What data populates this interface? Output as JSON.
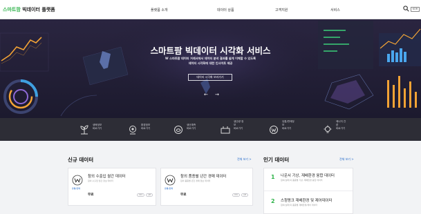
{
  "header": {
    "logo_brand": "스마트팜",
    "logo_rest": " 빅데이터 플랫폼",
    "nav": [
      "플랫폼 소개",
      "데이터 상품",
      "고객지원",
      "서비스"
    ],
    "lang": "KOR"
  },
  "hero": {
    "title": "스마트팜 빅데이터 시각화 서비스",
    "subtitle_line1": "W 스마트팜 데이터 거래서에서 데이터 분석 결과를 쉽게 이해할 수 있도록",
    "subtitle_line2": "데이터 시각화에 대한 인사이트 제공",
    "button": "데이터 시각화 보러가기",
    "prev": "←",
    "next": "→"
  },
  "services": [
    {
      "icon": "sprout-icon",
      "label_lines": [
        "생육정보",
        "바로가기"
      ]
    },
    {
      "icon": "environment-icon",
      "label_lines": [
        "환경정보",
        "바로가기"
      ]
    },
    {
      "icon": "yield-forecast-icon",
      "label_lines": [
        "생산예측",
        "바로가기"
      ]
    },
    {
      "icon": "production-cost-icon",
      "label_lines": [
        "생산량 정",
        "보",
        "바로가기"
      ]
    },
    {
      "icon": "distribution-icon",
      "label_lines": [
        "유통/판매정",
        "보",
        "바로가기"
      ]
    },
    {
      "icon": "energy-icon",
      "label_lines": [
        "에너지 관",
        "련",
        "바로가기"
      ]
    }
  ],
  "new_data": {
    "title": "신규 데이터",
    "more": "전체 보기 >",
    "items": [
      {
        "category": "유통/판매",
        "title": "참외 수출입 월간 데이터",
        "desc": "참외 수출입 월간 정보 데이터",
        "price": "무료",
        "badges": [
          "CSV",
          "API"
        ]
      },
      {
        "category": "유통/판매",
        "title": "참외 품종별 년간 경매 데이터",
        "desc": "참외 품종별 년간 경매 정보 데이터",
        "price": "무료",
        "badges": [
          "CSV",
          "API"
        ]
      }
    ]
  },
  "popular_data": {
    "title": "인기 데이터",
    "more": "전체 보기 >",
    "items": [
      {
        "rank": "1",
        "title": "나운서 기상, 재배환경 융합 데이터",
        "desc": "참외(설파)의 품종별 기상, 재배환경 융합 데이터"
      },
      {
        "rank": "2",
        "title": "스청펑크 재배환경 및 제어데이터",
        "desc": "참외(설파)의 품종별 재배환경/제어 데이터"
      }
    ]
  },
  "colors": {
    "brand_green": "#2fb34a",
    "hero_bg": "#1c1a2e",
    "service_bar": "#2d2d36",
    "link_blue": "#1d66c9"
  }
}
